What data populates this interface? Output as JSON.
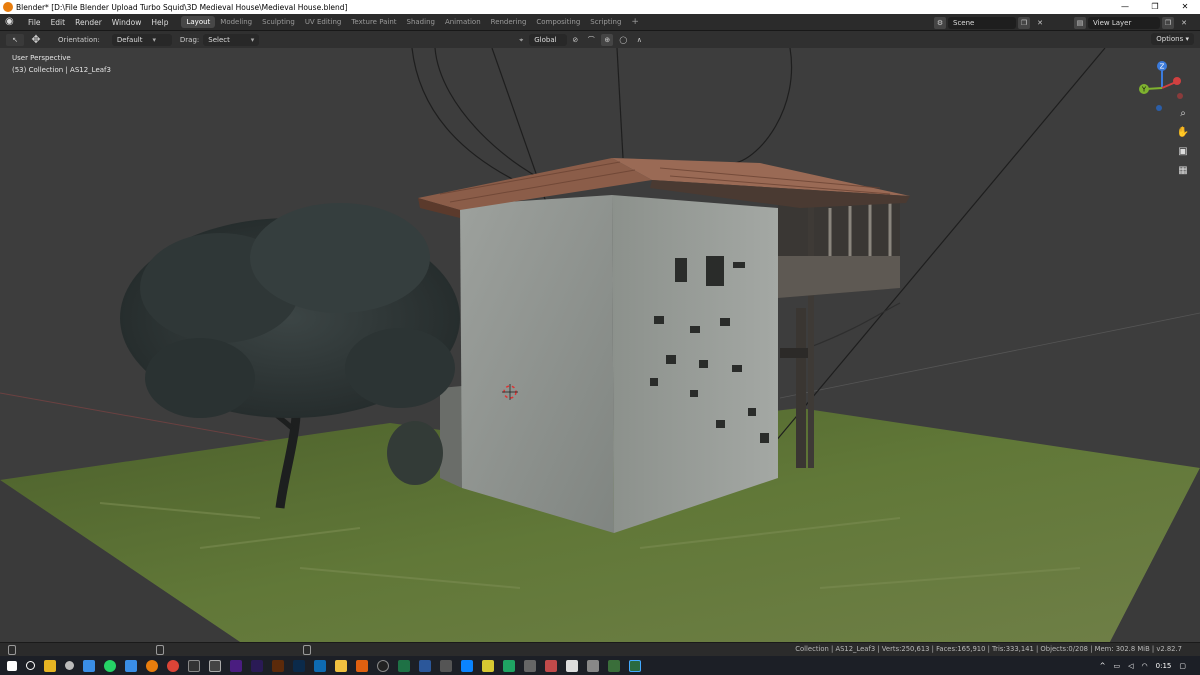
{
  "window": {
    "title": "Blender* [D:\\File Blender Upload Turbo Squid\\3D Medieval House\\Medieval House.blend]",
    "minimize": "—",
    "maximize": "❐",
    "close": "✕"
  },
  "menu": [
    "File",
    "Edit",
    "Render",
    "Window",
    "Help"
  ],
  "workspaces": [
    "Layout",
    "Modeling",
    "Sculpting",
    "UV Editing",
    "Texture Paint",
    "Shading",
    "Animation",
    "Rendering",
    "Compositing",
    "Scripting"
  ],
  "active_workspace": "Layout",
  "scene": {
    "name": "Scene",
    "view_layer": "View Layer"
  },
  "header": {
    "orientation_label": "Orientation:",
    "orientation_value": "Default",
    "drag_label": "Drag:",
    "drag_value": "Select Box",
    "transform_orientation": "Global",
    "options": "Options"
  },
  "viewport": {
    "perspective": "User Perspective",
    "collection": "(53) Collection | AS12_Leaf3"
  },
  "status": {
    "stats": "Collection | AS12_Leaf3 | Verts:250,613 | Faces:165,910 | Tris:333,141 | Objects:0/208 | Mem: 302.8 MiB | v2.82.7"
  },
  "taskbar": {
    "time": "0:15"
  },
  "gizmo": {
    "z": "Z",
    "y": "Y"
  },
  "colors": {
    "accent": "#e87d0d",
    "active_tab": "#474747",
    "viewport_bg": "#3d3d3d"
  }
}
